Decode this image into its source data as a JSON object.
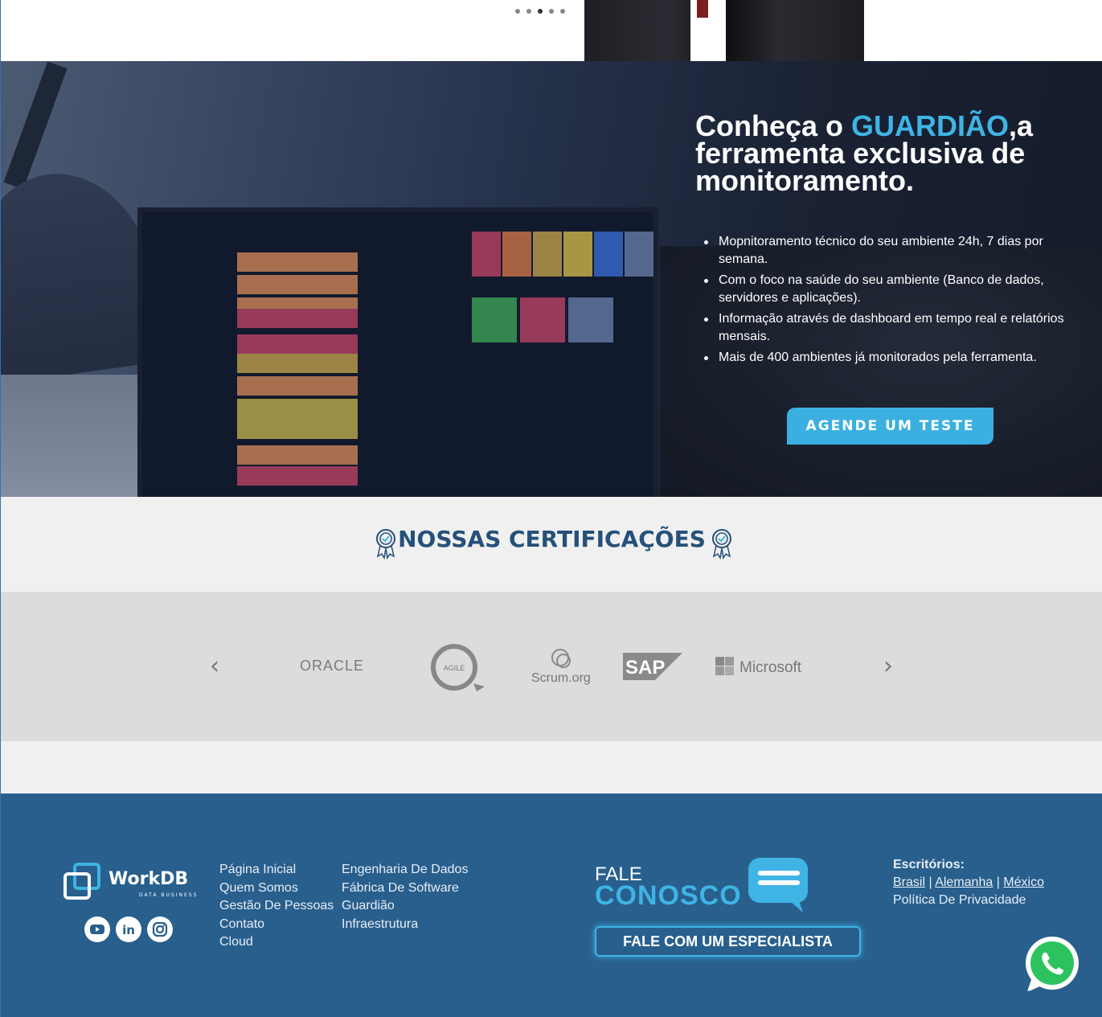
{
  "slider": {
    "dots": 5,
    "active_index": 2
  },
  "hero": {
    "title_prefix": "Conheça o ",
    "title_accent": "GUARDIÃO",
    "title_suffix": ",a ferramenta exclusiva de monitoramento.",
    "bullets": [
      "Mopnitoramento técnico do seu ambiente 24h, 7 dias por semana.",
      "Com o foco na saúde do seu ambiente (Banco de dados, servidores e aplicações).",
      "Informação através de dashboard em tempo real e relatórios mensais.",
      "Mais de 400 ambientes já monitorados pela ferramenta."
    ],
    "cta_label": "AGENDE UM TESTE"
  },
  "certifications": {
    "title": "NOSSAS CERTIFICAÇÕES",
    "logos": [
      "ORACLE",
      "AGILE",
      "Scrum.org",
      "SAP",
      "Microsoft"
    ],
    "prev_label": "‹",
    "next_label": "›"
  },
  "footer": {
    "brand_name": "WorkDB",
    "brand_tagline": "DATA BUSINESS",
    "social": [
      "youtube-icon",
      "linkedin-icon",
      "instagram-icon"
    ],
    "nav_col1": [
      "Página Inicial",
      "Quem Somos",
      "Gestão De Pessoas",
      "Contato",
      "Cloud"
    ],
    "nav_col2": [
      "Engenharia De Dados",
      "Fábrica De Software",
      "Guardião",
      "Infraestrutura"
    ],
    "fale_line1": "FALE",
    "fale_line2": "CONOSCO",
    "especialista_label": "FALE COM UM ESPECIALISTA",
    "offices_label": "Escritórios:",
    "offices": [
      "Brasil",
      "Alemanha",
      "México"
    ],
    "separator": "|",
    "privacy": "Política De Privacidade"
  },
  "colors": {
    "accent": "#3fb4e5",
    "footer_bg": "#285f8d",
    "heading": "#25507a"
  }
}
